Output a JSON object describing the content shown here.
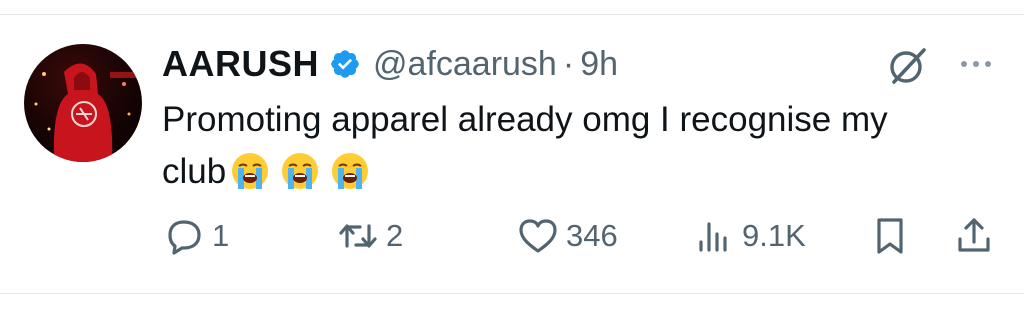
{
  "tweet": {
    "author_name": "AARUSH",
    "handle": "@afcaarush",
    "separator": "·",
    "time": "9h",
    "text_line1": "Promoting apparel already omg I recognise my",
    "text_line2": "club",
    "emojis": [
      "loudly-crying-face",
      "loudly-crying-face",
      "loudly-crying-face"
    ]
  },
  "actions": {
    "replies": "1",
    "reposts": "2",
    "likes": "346",
    "views": "9.1K"
  },
  "colors": {
    "text": "#0f1419",
    "secondary": "#536471",
    "verified_blue": "#1d9bf0",
    "divider": "#e6e9ec"
  },
  "icons": [
    "grok-icon",
    "more-icon",
    "reply-icon",
    "repost-icon",
    "like-icon",
    "views-icon",
    "bookmark-icon",
    "share-icon",
    "verified-badge-icon"
  ]
}
